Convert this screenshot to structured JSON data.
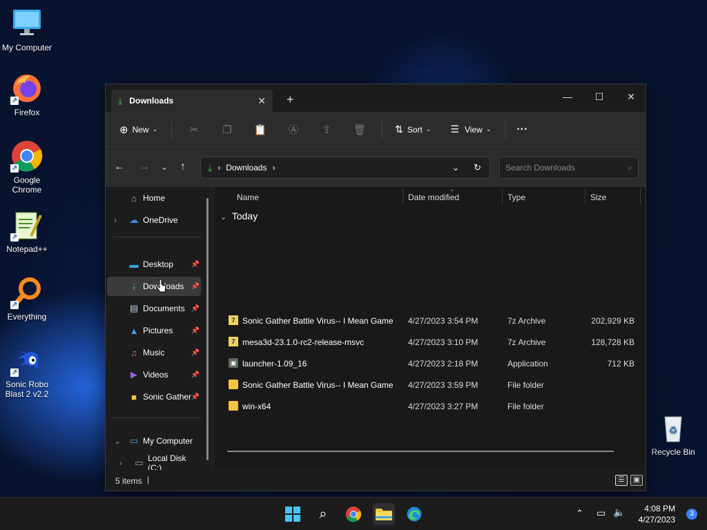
{
  "desktop": {
    "icons": [
      {
        "label": "My Computer"
      },
      {
        "label": "Firefox"
      },
      {
        "label": "Google Chrome"
      },
      {
        "label": "Notepad++"
      },
      {
        "label": "Everything"
      },
      {
        "label": "Sonic Robo Blast 2 v2.2"
      },
      {
        "label": "Recycle Bin"
      }
    ]
  },
  "window": {
    "tab_title": "Downloads",
    "toolbar": {
      "new_label": "New",
      "sort_label": "Sort",
      "view_label": "View",
      "more_label": "···"
    },
    "address": {
      "crumb": "Downloads"
    },
    "search": {
      "placeholder": "Search Downloads"
    },
    "sidebar": {
      "top": [
        {
          "label": "Home"
        },
        {
          "label": "OneDrive"
        }
      ],
      "pinned": [
        {
          "label": "Desktop"
        },
        {
          "label": "Downloads"
        },
        {
          "label": "Documents"
        },
        {
          "label": "Pictures"
        },
        {
          "label": "Music"
        },
        {
          "label": "Videos"
        },
        {
          "label": "Sonic Gather"
        }
      ],
      "bottom": [
        {
          "label": "My Computer"
        },
        {
          "label": "Local Disk (C:)"
        }
      ]
    },
    "columns": {
      "name": "Name",
      "date": "Date modified",
      "type": "Type",
      "size": "Size"
    },
    "group": "Today",
    "files": [
      {
        "name": "Sonic Gather Battle Virus-- I Mean Game",
        "date": "4/27/2023 3:54 PM",
        "type": "7z Archive",
        "size": "202,929 KB",
        "icon": "archive-icon"
      },
      {
        "name": "mesa3d-23.1.0-rc2-release-msvc",
        "date": "4/27/2023 3:10 PM",
        "type": "7z Archive",
        "size": "128,728 KB",
        "icon": "archive-icon"
      },
      {
        "name": "launcher-1.09_16",
        "date": "4/27/2023 2:18 PM",
        "type": "Application",
        "size": "712 KB",
        "icon": "application-icon"
      },
      {
        "name": "Sonic Gather Battle Virus-- I Mean Game",
        "date": "4/27/2023 3:59 PM",
        "type": "File folder",
        "size": "",
        "icon": "folder-icon"
      },
      {
        "name": "win-x64",
        "date": "4/27/2023 3:27 PM",
        "type": "File folder",
        "size": "",
        "icon": "folder-icon"
      }
    ],
    "status": "5 items"
  },
  "taskbar": {
    "time": "4:08 PM",
    "date": "4/27/2023",
    "notification_count": "3"
  },
  "colors": {
    "accent": "#3b82f6",
    "folder": "#f5c542",
    "download_arrow": "#3fb950"
  }
}
